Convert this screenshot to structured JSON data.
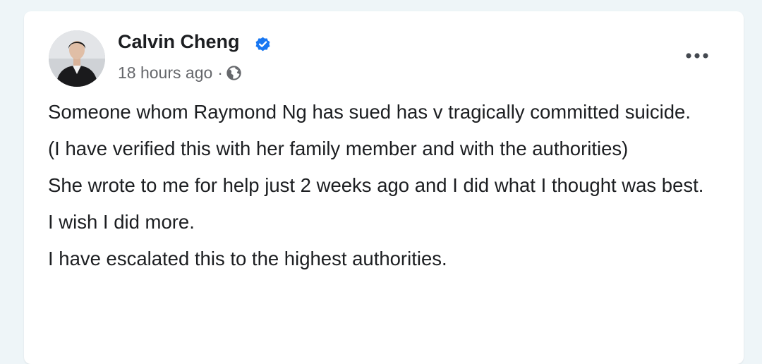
{
  "post": {
    "author": "Calvin Cheng",
    "verified": true,
    "timestamp": "18 hours ago",
    "separator": "·",
    "audience_icon": "globe-icon",
    "more_icon": "more-options-icon",
    "paragraphs": [
      "Someone whom Raymond Ng has sued has v tragically committed suicide.",
      "(I have verified this with her family member and with the authorities)",
      "She wrote to me for help just 2 weeks ago and I did what I thought was best.",
      "I wish I did more.",
      "I have escalated this to the highest authorities."
    ]
  },
  "colors": {
    "page_background": "#eef5f8",
    "card_background": "#ffffff",
    "text_primary": "#1c1e21",
    "text_secondary": "#65676b",
    "verified_blue": "#1877f2"
  }
}
